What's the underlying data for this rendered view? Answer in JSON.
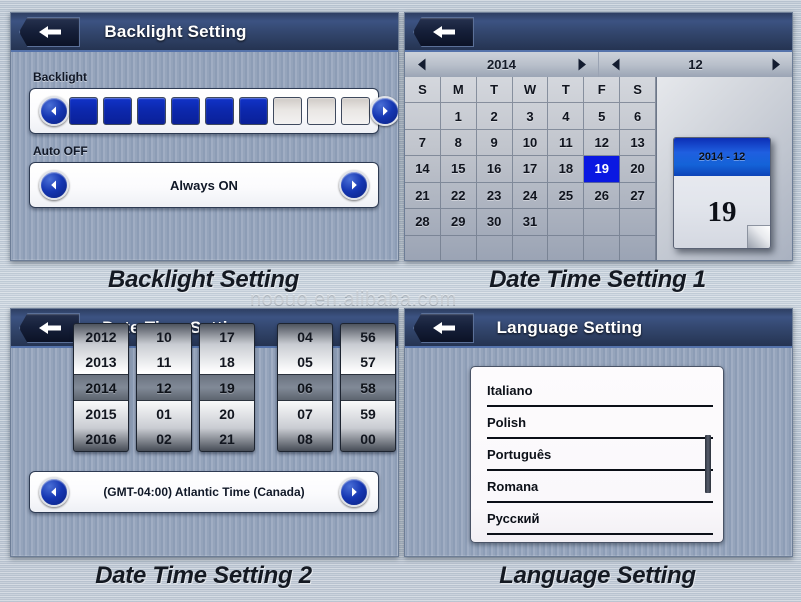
{
  "watermark": "noouo.en.alibaba.com",
  "captions": {
    "backlight": "Backlight Setting",
    "datetime1": "Date Time Setting 1",
    "datetime2": "Date Time Setting 2",
    "language": "Language Setting"
  },
  "backlight_screen": {
    "title": "Backlight Setting",
    "back_icon": "back-arrow-icon",
    "backlight_label": "Backlight",
    "backlight_level": 6,
    "backlight_total": 9,
    "auto_off_label": "Auto OFF",
    "auto_off_value": "Always ON",
    "left_arrow_icon": "chevron-left-icon",
    "right_arrow_icon": "chevron-right-icon"
  },
  "datetime1_screen": {
    "title": "",
    "back_icon": "back-arrow-icon",
    "year": "2014",
    "month": "12",
    "prev_year_icon": "triangle-left-icon",
    "next_year_icon": "triangle-right-icon",
    "prev_month_icon": "triangle-left-icon",
    "next_month_icon": "triangle-right-icon",
    "weekday_headers": [
      "S",
      "M",
      "T",
      "W",
      "T",
      "F",
      "S"
    ],
    "day_cells": [
      "",
      "1",
      "2",
      "3",
      "4",
      "5",
      "6",
      "7",
      "8",
      "9",
      "10",
      "11",
      "12",
      "13",
      "14",
      "15",
      "16",
      "17",
      "18",
      "19",
      "20",
      "21",
      "22",
      "23",
      "24",
      "25",
      "26",
      "27",
      "28",
      "29",
      "30",
      "31",
      "",
      "",
      "",
      "",
      "",
      "",
      "",
      "",
      "",
      ""
    ],
    "selected_day": "19",
    "selected_index": 19,
    "preview_card": {
      "header": "2014 - 12",
      "day": "19"
    }
  },
  "datetime2_screen": {
    "title": "Date Time Setting",
    "back_icon": "back-arrow-icon",
    "spinners": [
      {
        "name": "year-spinner",
        "items": [
          "2012",
          "2013",
          "2014",
          "2015",
          "2016"
        ],
        "selected": "2014"
      },
      {
        "name": "month-spinner",
        "items": [
          "10",
          "11",
          "12",
          "01",
          "02"
        ],
        "selected": "12"
      },
      {
        "name": "day-spinner",
        "items": [
          "17",
          "18",
          "19",
          "20",
          "21"
        ],
        "selected": "19"
      },
      {
        "name": "hour-spinner",
        "items": [
          "04",
          "05",
          "06",
          "07",
          "08"
        ],
        "selected": "06"
      },
      {
        "name": "minute-spinner",
        "items": [
          "56",
          "57",
          "58",
          "59",
          "00"
        ],
        "selected": "58"
      }
    ],
    "timezone": "(GMT-04:00) Atlantic Time (Canada)",
    "left_arrow_icon": "chevron-left-icon",
    "right_arrow_icon": "chevron-right-icon"
  },
  "language_screen": {
    "title": "Language Setting",
    "back_icon": "back-arrow-icon",
    "languages": [
      "Italiano",
      "Polish",
      "Português",
      "Romana",
      "Русский"
    ],
    "scrollbar": "vertical-scrollbar"
  },
  "colors": {
    "accent_blue": "#0a18e2",
    "titlebar_blue": "#32456c",
    "panel_blue": "#95a4bb",
    "button_blue": "#1536b2"
  }
}
